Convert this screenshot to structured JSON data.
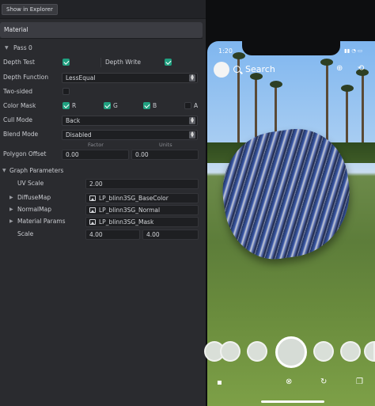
{
  "toolbar": {
    "show_in_explorer": "Show in Explorer"
  },
  "panel": {
    "header": "Material",
    "pass": "Pass 0",
    "depth_test": "Depth Test",
    "depth_write": "Depth Write",
    "depth_function_label": "Depth Function",
    "depth_function_value": "LessEqual",
    "two_sided": "Two-sided",
    "color_mask": "Color Mask",
    "mask_r": "R",
    "mask_g": "G",
    "mask_b": "B",
    "mask_a": "A",
    "cull_mode_label": "Cull Mode",
    "cull_mode_value": "Back",
    "blend_mode_label": "Blend Mode",
    "blend_mode_value": "Disabled",
    "factor": "Factor",
    "units": "Units",
    "polygon_offset": "Polygon Offset",
    "polygon_factor": "0.00",
    "polygon_units": "0.00",
    "graph_parameters": "Graph Parameters",
    "uv_scale_label": "UV Scale",
    "uv_scale_value": "2.00",
    "diffuse_label": "DiffuseMap",
    "diffuse_value": "LP_blinn3SG_BaseColor",
    "normal_label": "NormalMap",
    "normal_value": "LP_blinn3SG_Normal",
    "material_params_label": "Material Params",
    "material_params_value": "LP_blinn3SG_Mask",
    "scale_label": "Scale",
    "scale_x": "4.00",
    "scale_y": "4.00"
  },
  "preview": {
    "time": "1:20",
    "search": "Search",
    "colors": {
      "accent": "#20a080",
      "sky": "#9cc6f0",
      "grass": "#5d7d3a"
    }
  }
}
